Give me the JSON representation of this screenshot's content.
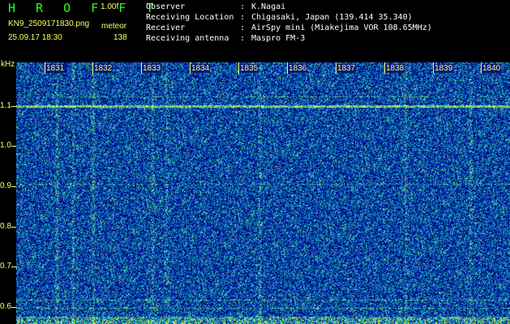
{
  "header": {
    "brand": "H R O F F T",
    "version": "1.00f",
    "filename": "KN9_2509171830.png",
    "mode": "meteor",
    "datetime": "25.09.17 18:30",
    "count": "138"
  },
  "info": [
    {
      "key": "Observer",
      "value": "K.Nagai"
    },
    {
      "key": "Receiving Location",
      "value": "Chigasaki, Japan (139.414 35.340)"
    },
    {
      "key": "Receiver",
      "value": "AirSpy mini (Miakejima VOR 108.65MHz)"
    },
    {
      "key": "Receiving antenna",
      "value": "Maspro FM-3"
    }
  ],
  "axis": {
    "y_unit": "kHz",
    "y_labels": [
      "1.1",
      "1.0",
      "0.9",
      "0.8",
      "0.7",
      "0.6"
    ],
    "minute_labels": [
      "1831",
      "1832",
      "1833",
      "1834",
      "1835",
      "1836",
      "1837",
      "1838",
      "1839",
      "1840"
    ]
  },
  "colors": {
    "background": "#001a7a",
    "text_yellow": "#ffff66",
    "brand_green": "#22ff22"
  }
}
